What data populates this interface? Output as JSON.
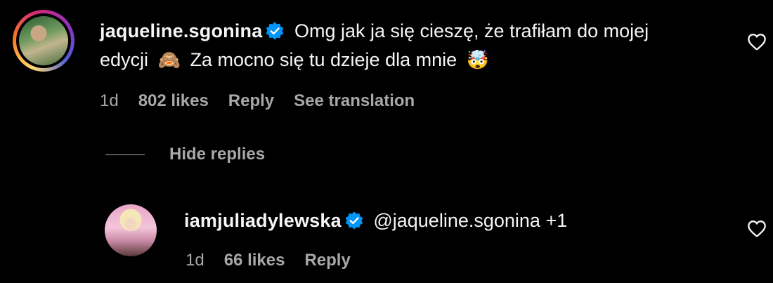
{
  "comment": {
    "username": "jaqueline.sgonina",
    "text_line1": "Omg jak ja się cieszę, że trafiłam do mojej",
    "text_line2_a": "edycji",
    "emoji1": "🙈",
    "text_line2_b": "Za mocno się tu dzieje dla mnie",
    "emoji2": "🤯",
    "time": "1d",
    "likes": "802 likes",
    "reply": "Reply",
    "see_translation": "See translation"
  },
  "replies_toggle": {
    "label": "Hide replies"
  },
  "reply": {
    "username": "iamjuliadylewska",
    "mention": "@jaqueline.sgonina",
    "extra": "+1",
    "time": "1d",
    "likes": "66 likes",
    "reply": "Reply"
  },
  "icons": {
    "verified": "verified-badge-icon",
    "heart": "heart-outline-icon"
  },
  "colors": {
    "background": "#000000",
    "text": "#f5f5f5",
    "secondary": "#a8a8a8",
    "verified": "#0095f6"
  }
}
